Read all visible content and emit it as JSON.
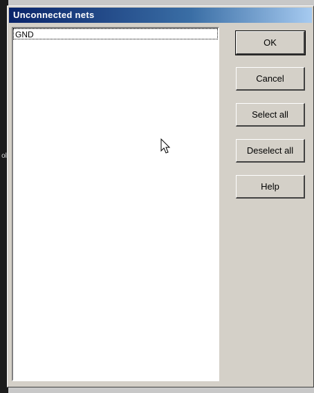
{
  "window": {
    "title": "Unconnected nets"
  },
  "nets_list": {
    "items": [
      "GND"
    ]
  },
  "buttons": {
    "ok": "OK",
    "cancel": "Cancel",
    "select_all": "Select all",
    "deselect_all": "Deselect all",
    "help": "Help"
  },
  "background": {
    "edge_text": "ol"
  }
}
